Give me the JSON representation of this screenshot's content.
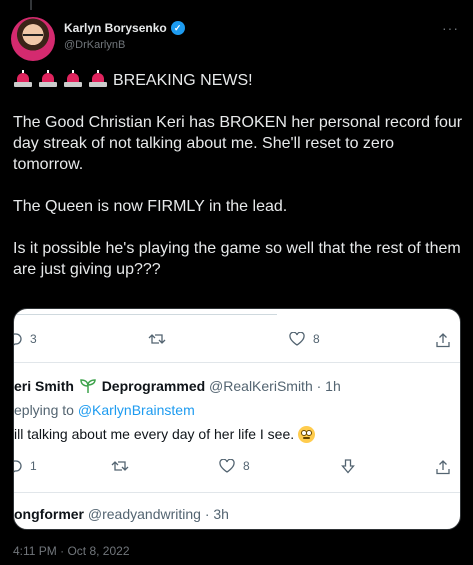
{
  "author": {
    "name": "Karlyn Borysenko",
    "handle": "@DrKarlynB",
    "verified": true
  },
  "tweet": {
    "headline": "BREAKING NEWS!",
    "siren_count": 4,
    "paragraphs": [
      "The Good Christian Keri has BROKEN her personal record four day streak of not talking about me. She'll reset to zero tomorrow.",
      "The Queen is now FIRMLY in the lead.",
      "Is it possible he's playing the game so well that the rest of them are just giving up???"
    ],
    "timestamp": "4:11 PM · Oct 8, 2022"
  },
  "embedded_screenshot": {
    "top_actions": {
      "replies": "3",
      "likes": "8"
    },
    "reply": {
      "name": "eri Smith",
      "name_suffix": "Deprogrammed",
      "handle_time": "@RealKeriSmith · 1h",
      "replying_prefix": "eplying to ",
      "replying_to": "@KarlynBrainstem",
      "body": "ill talking about me every day of her life I see."
    },
    "reply_actions": {
      "replies": "1",
      "likes": "8"
    },
    "next": {
      "name": "ongformer",
      "handle_time": "@readyandwriting · 3h"
    }
  },
  "colors": {
    "background": "#000000",
    "text": "#e7e9ea",
    "muted": "#71767b",
    "accent": "#1d9bf0",
    "verified_badge": "#1d9bf0"
  },
  "icons": [
    "verified-badge-icon",
    "more-icon",
    "siren-icon",
    "reply-icon",
    "retweet-icon",
    "like-icon",
    "share-icon",
    "downvote-icon",
    "sprout-icon",
    "eye-roll-emoji-icon"
  ]
}
